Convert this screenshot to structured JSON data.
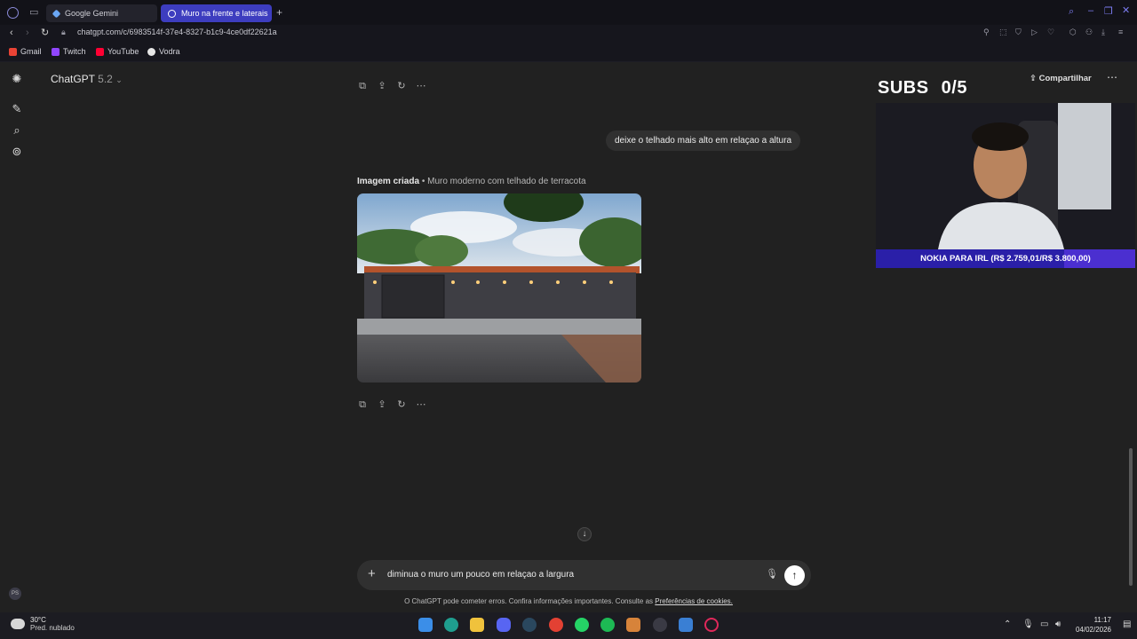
{
  "browser": {
    "tabs": [
      {
        "label": "Google Gemini",
        "active": false
      },
      {
        "label": "Muro na frente e laterais",
        "active": true
      }
    ],
    "url": "chatgpt.com/c/6983514f-37e4-8327-b1c9-4ce0df22621a",
    "bookmarks": [
      "Gmail",
      "Twitch",
      "YouTube",
      "Vodra"
    ]
  },
  "app": {
    "model_name": "ChatGPT",
    "model_version": "5.2",
    "share_label": "Compartilhar",
    "user_message": "deixe o telhado mais alto em relaçao a altura",
    "image_caption_bold": "Imagem criada",
    "image_caption_separator": " • ",
    "image_caption_title": "Muro moderno com telhado de terracota",
    "composer_text": "diminua o muro um pouco em relaçao a largura",
    "disclaimer_text": "O ChatGPT pode cometer erros. Confira informações importantes. Consulte as",
    "disclaimer_link": "Preferências de cookies.",
    "avatar_initials": "PS"
  },
  "overlay": {
    "subs_label": "SUBS",
    "subs_count": "0/5",
    "goal_text": "NOKIA PARA IRL (R$ 2.759,01/R$ 3.800,00)",
    "goal_progress": 0.726
  },
  "taskbar": {
    "temperature": "30°C",
    "weather_desc": "Pred. nublado",
    "time": "11:17",
    "date": "04/02/2026"
  },
  "colors": {
    "tab_active": "#3d3dbf",
    "goal_bar": "#4b2fd0",
    "background": "#212121"
  }
}
